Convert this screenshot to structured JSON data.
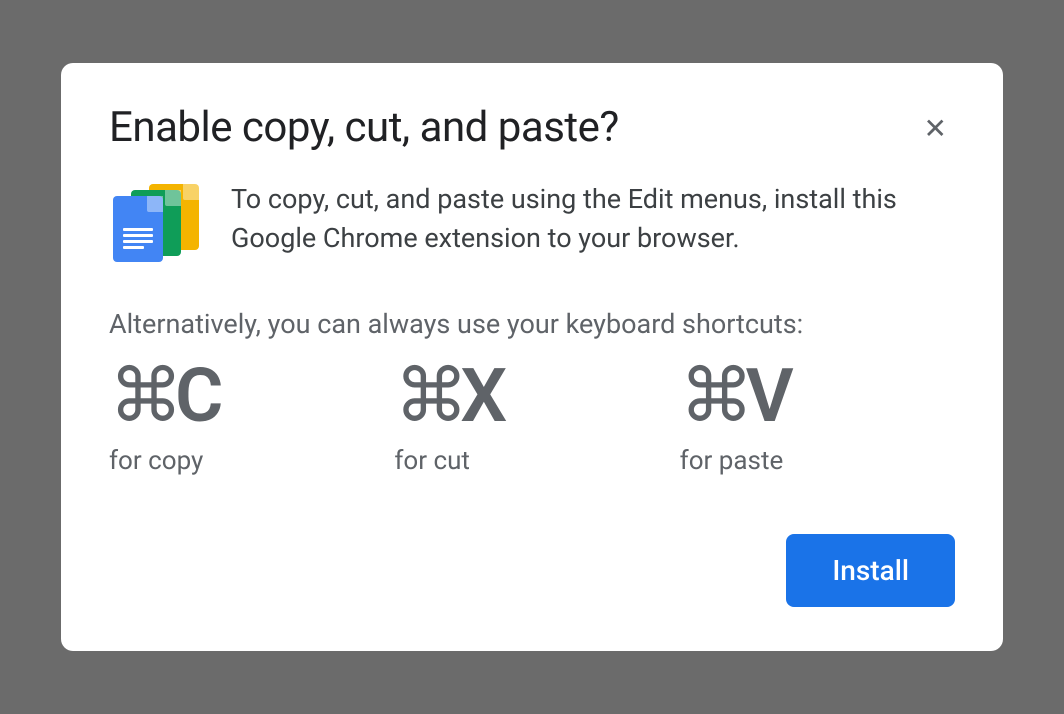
{
  "dialog": {
    "title": "Enable copy, cut, and paste?",
    "intro_text": "To copy, cut, and paste using the Edit menus, install this Google Chrome extension to your browser.",
    "alt_text": "Alternatively, you can always use your keyboard shortcuts:",
    "shortcuts": {
      "copy": {
        "key": "C",
        "label": "for copy"
      },
      "cut": {
        "key": "X",
        "label": "for cut"
      },
      "paste": {
        "key": "V",
        "label": "for paste"
      }
    },
    "install_label": "Install"
  },
  "icons": {
    "command_symbol": "⌘",
    "close_symbol": "✕"
  }
}
